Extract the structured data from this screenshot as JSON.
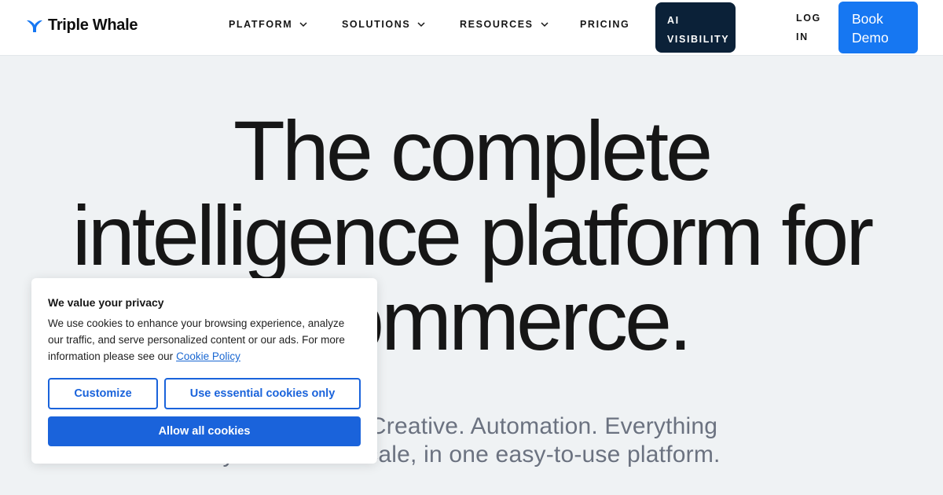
{
  "brand": {
    "name": "Triple Whale",
    "logo_icon": "whale-tail-logo-icon",
    "accent": "#1677f2"
  },
  "nav": {
    "items": [
      {
        "label": "PLATFORM",
        "icon": "chevron-down-icon"
      },
      {
        "label": "SOLUTIONS",
        "icon": "chevron-down-icon"
      },
      {
        "label": "RESOURCES",
        "icon": "chevron-down-icon"
      },
      {
        "label": "PRICING"
      }
    ],
    "ai_visibility": {
      "line1": "AI",
      "line2": "VISIBILITY",
      "bg": "#0b2138"
    },
    "login": {
      "line1": "LOG",
      "line2": "IN"
    },
    "book_demo": {
      "line1": "Book",
      "line2": "Demo",
      "bg": "#1677f2"
    }
  },
  "hero": {
    "title_line1": "The complete",
    "title_line2": "intelligence platform for",
    "title_line3": "ecommerce.",
    "subtitle_line1": "Analytics. AI. Creative. Automation. Everything",
    "subtitle_line2": "you need to scale, in one easy-to-use platform."
  },
  "cookie_banner": {
    "title": "We value your privacy",
    "body": "We use cookies to enhance your browsing experience, analyze our traffic, and serve personalized content or our ads. For more information please see our",
    "link": "Cookie Policy",
    "customize": "Customize",
    "essential_only": "Use essential cookies only",
    "allow_all": "Allow all cookies",
    "button_color": "#1a63db"
  }
}
